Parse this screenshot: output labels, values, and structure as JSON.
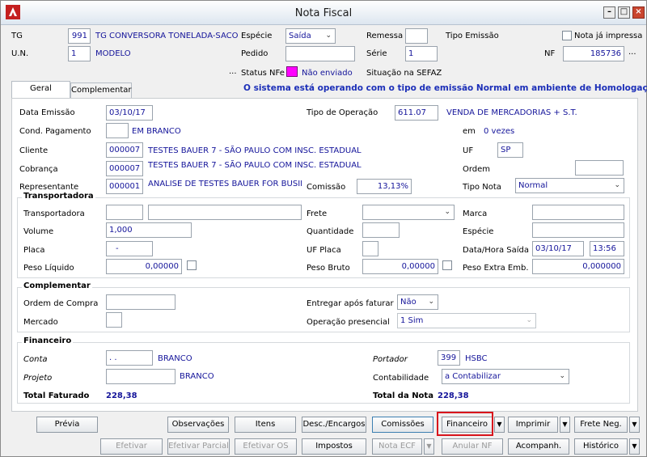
{
  "window": {
    "title": "Nota Fiscal",
    "min": "–",
    "max": "□",
    "close": "×"
  },
  "header": {
    "tg_label": "TG",
    "tg_code": "991",
    "tg_name": "TG CONVERSORA TONELADA-SACO",
    "un_label": "U.N.",
    "un_code": "1",
    "un_name": "MODELO",
    "especie_label": "Espécie",
    "especie_value": "Saída",
    "pedido_label": "Pedido",
    "pedido_value": "",
    "remessa_label": "Remessa",
    "remessa_value": "",
    "serie_label": "Série",
    "serie_value": "1",
    "tipo_emissao_label": "Tipo Emissão",
    "nota_impressa_label": "Nota já impressa",
    "nf_label": "NF",
    "nf_value": "185736",
    "ellipsis": "...",
    "status_nfe_label": "Status NFe",
    "status_nfe_value": "Não enviado",
    "situacao_sefaz_label": "Situação na SEFAZ"
  },
  "tabs": [
    {
      "label": "Geral"
    },
    {
      "label": "Complementar"
    }
  ],
  "banner": "O sistema está operando com o tipo de emissão Normal em ambiente de Homologação",
  "geral": {
    "data_emissao_label": "Data Emissão",
    "data_emissao_value": "03/10/17",
    "tipo_operacao_label": "Tipo de Operação",
    "tipo_operacao_code": "611.07",
    "tipo_operacao_desc": "VENDA DE MERCADORIAS + S.T.",
    "cond_pag_label": "Cond. Pagamento",
    "cond_pag_code": "",
    "cond_pag_desc": "EM BRANCO",
    "em_label": "em",
    "em_value": "0 vezes",
    "cliente_label": "Cliente",
    "cliente_code": "000007",
    "cliente_name": "TESTES BAUER 7 - SÃO PAULO COM INSC. ESTADUAL",
    "uf_label": "UF",
    "uf_value": "SP",
    "cobranca_label": "Cobrança",
    "cobranca_code": "000007",
    "cobranca_name": "TESTES BAUER 7 - SÃO PAULO COM INSC. ESTADUAL",
    "ordem_label": "Ordem",
    "ordem_value": "",
    "representante_label": "Representante",
    "representante_code": "000001",
    "representante_name": "ANALISE DE TESTES BAUER FOR BUSINES!",
    "comissao_label": "Comissão",
    "comissao_value": "13,13%",
    "tipo_nota_label": "Tipo Nota",
    "tipo_nota_value": "Normal"
  },
  "transportadora": {
    "title": "Transportadora",
    "transportadora_label": "Transportadora",
    "frete_label": "Frete",
    "frete_value": "",
    "marca_label": "Marca",
    "volume_label": "Volume",
    "volume_value": "1,000",
    "quantidade_label": "Quantidade",
    "especie_label": "Espécie",
    "placa_label": "Placa",
    "placa_value": "-",
    "uf_placa_label": "UF Placa",
    "data_hora_saida_label": "Data/Hora Saída",
    "data_saida_value": "03/10/17",
    "hora_saida_value": "13:56",
    "peso_liquido_label": "Peso Líquido",
    "peso_liquido_value": "0,00000",
    "peso_bruto_label": "Peso Bruto",
    "peso_bruto_value": "0,00000",
    "peso_extra_label": "Peso Extra Emb.",
    "peso_extra_value": "0,000000"
  },
  "complementar": {
    "title": "Complementar",
    "ordem_compra_label": "Ordem de Compra",
    "entregar_label": "Entregar após faturar",
    "entregar_value": "Não",
    "mercado_label": "Mercado",
    "operacao_presencial_label": "Operação presencial",
    "operacao_presencial_value": "1 Sim"
  },
  "financeiro": {
    "title": "Financeiro",
    "conta_label": "Conta",
    "conta_value": ". .",
    "conta_desc": "BRANCO",
    "portador_label": "Portador",
    "portador_code": "399",
    "portador_name": "HSBC",
    "projeto_label": "Projeto",
    "projeto_desc": "BRANCO",
    "contabilidade_label": "Contabilidade",
    "contabilidade_value": "a Contabilizar",
    "total_faturado_label": "Total Faturado",
    "total_faturado_value": "228,38",
    "total_nota_label": "Total da Nota",
    "total_nota_value": "228,38"
  },
  "buttons": {
    "previa": "Prévia",
    "observacoes": "Observações",
    "itens": "Itens",
    "desc_encargos": "Desc./Encargos",
    "comissoes": "Comissões",
    "financeiro": "Financeiro",
    "imprimir": "Imprimir",
    "frete_neg": "Frete Neg.",
    "efetivar": "Efetivar",
    "efetivar_parcial": "Efetivar Parcial",
    "efetivar_os": "Efetivar OS",
    "impostos": "Impostos",
    "nota_ecf": "Nota ECF",
    "anular_nf": "Anular NF",
    "acompanh": "Acompanh.",
    "historico": "Histórico",
    "dropdown": "▼"
  },
  "colors": {
    "highlight": "#d8141c",
    "value_text": "#14149a",
    "banner": "#1c2fb8",
    "status_nfe": "#ff00ff"
  }
}
